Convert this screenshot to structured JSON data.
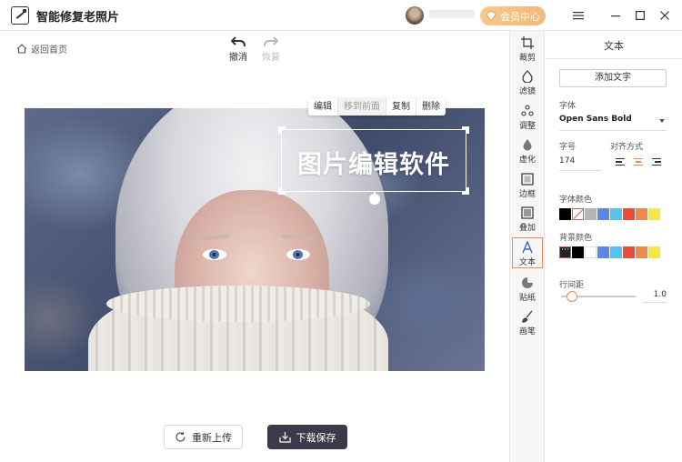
{
  "app": {
    "title": "智能修复老照片",
    "vip_label": "会员中心"
  },
  "toolbar": {
    "back_label": "返回首页",
    "undo_label": "撤消",
    "redo_label": "恢复"
  },
  "context_menu": {
    "items": [
      "编辑",
      "移到前面",
      "复制",
      "删除"
    ]
  },
  "canvas": {
    "overlay_text": "图片编辑软件"
  },
  "bottom": {
    "reupload_label": "重新上传",
    "download_label": "下载保存"
  },
  "tools": [
    {
      "label": "裁剪",
      "icon": "crop-icon"
    },
    {
      "label": "滤镜",
      "icon": "filter-icon"
    },
    {
      "label": "调整",
      "icon": "adjust-icon"
    },
    {
      "label": "虚化",
      "icon": "blur-icon"
    },
    {
      "label": "边框",
      "icon": "border-icon"
    },
    {
      "label": "叠加",
      "icon": "overlay-icon"
    },
    {
      "label": "文本",
      "icon": "text-icon",
      "active": true
    },
    {
      "label": "贴纸",
      "icon": "sticker-icon"
    },
    {
      "label": "画笔",
      "icon": "brush-icon"
    }
  ],
  "panel": {
    "title": "文本",
    "add_text_label": "添加文字",
    "font_label": "字体",
    "font_value": "Open Sans Bold",
    "size_label": "字号",
    "size_value": "174",
    "align_label": "对齐方式",
    "font_color_label": "字体颜色",
    "bg_color_label": "背景颜色",
    "line_spacing_label": "行间距",
    "line_spacing_value": "1.0",
    "line_spacing_level": 0.15,
    "font_colors": [
      "#000000",
      "none",
      "#b5b5b5",
      "#5b86e5",
      "#5bc0eb",
      "#e84c3d",
      "#f08a4b",
      "#f7e64a"
    ],
    "bg_colors": [
      "dots",
      "#000000",
      "#ffffff",
      "#5b86e5",
      "#5bc0eb",
      "#e84c3d",
      "#f08a4b",
      "#f7e64a"
    ]
  },
  "colors": {
    "accent": "#f0875b",
    "dark_button": "#3a3a4a",
    "vip_gradient_start": "#f6c88e"
  }
}
